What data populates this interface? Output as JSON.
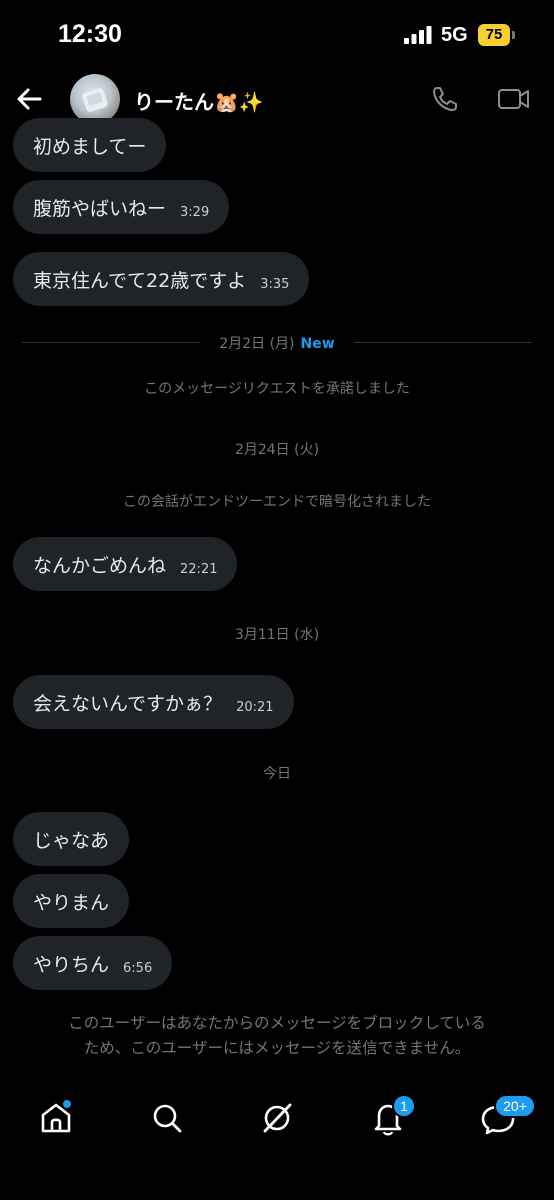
{
  "status_bar": {
    "time": "12:30",
    "network": "5G",
    "battery": "75",
    "battery_color": "#f7d02c"
  },
  "header": {
    "contact_name": "りーたん🐹✨",
    "icons": [
      "back-arrow-icon",
      "phone-icon",
      "video-camera-icon"
    ]
  },
  "messages": [
    {
      "text": "初めましてー",
      "time": ""
    },
    {
      "text": "腹筋やばいねー",
      "time": "3:29"
    },
    {
      "text": "東京住んでて22歳ですよ",
      "time": "3:35"
    },
    {
      "text": "なんかごめんね",
      "time": "22:21"
    },
    {
      "text": "会えないんですかぁ？",
      "time": "20:21"
    },
    {
      "text": "じゃなあ",
      "time": ""
    },
    {
      "text": "やりまん",
      "time": ""
    },
    {
      "text": "やりちん",
      "time": "6:56"
    }
  ],
  "system": {
    "date_feb2": "2月2日 (月)",
    "new_label": "New",
    "request_accepted": "このメッセージリクエストを承諾しました",
    "date_feb24": "2月24日 (火)",
    "encrypted": "この会話がエンドツーエンドで暗号化されました",
    "date_mar11": "3月11日 (水)",
    "today": "今日"
  },
  "blocked_notice": {
    "line1": "このユーザーはあなたからのメッセージをブロックしている",
    "line2": "ため、このユーザーにはメッセージを送信できません。"
  },
  "bottom_nav": {
    "items": [
      "home-icon",
      "search-icon",
      "grok-icon",
      "notifications-icon",
      "messages-icon"
    ],
    "notifications_badge": "1",
    "messages_badge": "20+"
  },
  "colors": {
    "accent": "#1d9bf0",
    "bubble": "#202327",
    "background": "#000000"
  }
}
